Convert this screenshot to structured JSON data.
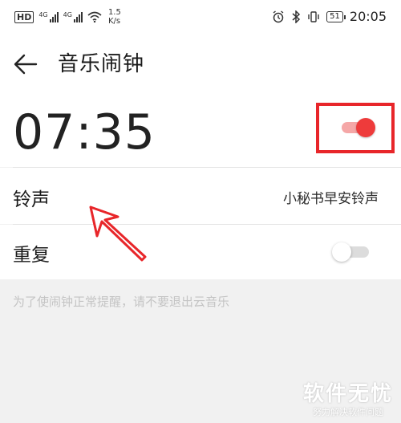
{
  "status_bar": {
    "hd_label": "HD",
    "sim1_label": "4G",
    "sim2_label": "4G",
    "net_speed": "1.5",
    "net_speed_unit": "K/s",
    "battery": "51",
    "time": "20:05",
    "icons": [
      "hd-icon",
      "signal-icon",
      "signal-icon",
      "wifi-icon",
      "alarm-icon",
      "bluetooth-icon",
      "vibrate-icon",
      "battery-icon"
    ]
  },
  "app_bar": {
    "back_icon": "arrow-left-icon",
    "title": "音乐闹钟"
  },
  "alarm": {
    "time": "07:35",
    "enabled": true
  },
  "settings": {
    "ringtone_label": "铃声",
    "ringtone_value": "小秘书早安铃声",
    "repeat_label": "重复",
    "repeat_enabled": false
  },
  "hint": "为了使闹钟正常提醒，请不要退出云音乐",
  "watermark": {
    "main": "软件无忧",
    "sub": "努力解决软件问题"
  },
  "colors": {
    "accent": "#ee3b3b",
    "annotation": "#e8262a",
    "background": "#f1f1f1"
  }
}
